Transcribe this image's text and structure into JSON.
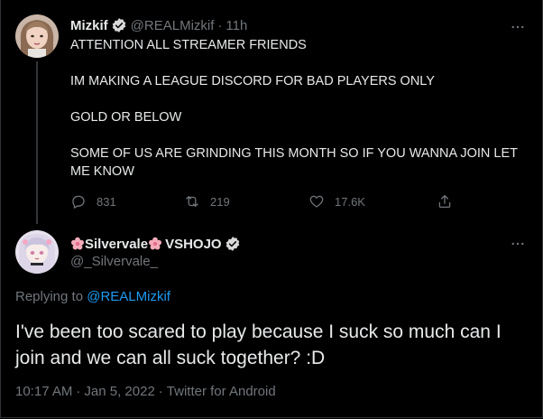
{
  "colors": {
    "background": "#000000",
    "text_primary": "#e7e9ea",
    "text_secondary": "#71767b",
    "link": "#1d9bf0",
    "verified": "#1d9bf0",
    "thread_line": "#333639"
  },
  "parent_tweet": {
    "avatar_icon": "mizkif-avatar",
    "display_name": "Mizkif",
    "handle": "@REALMizkif",
    "separator": "·",
    "time": "11h",
    "more_icon": "more-dots-icon",
    "paragraphs": [
      "ATTENTION ALL STREAMER FRIENDS",
      "IM MAKING A LEAGUE DISCORD FOR BAD PLAYERS ONLY",
      "GOLD OR BELOW",
      "SOME OF US ARE GRINDING THIS MONTH SO IF YOU WANNA JOIN LET ME KNOW"
    ],
    "actions": {
      "reply": {
        "icon": "reply-icon",
        "count": "831"
      },
      "retweet": {
        "icon": "retweet-icon",
        "count": "219"
      },
      "like": {
        "icon": "heart-icon",
        "count": "17.6K"
      },
      "share": {
        "icon": "share-icon"
      }
    }
  },
  "reply_tweet": {
    "avatar_icon": "silvervale-avatar",
    "display_name": "Silvervale",
    "display_name_suffix": "VSHOJO",
    "name_emoji_icon": "cherry-blossom-icon",
    "handle": "@_Silvervale_",
    "more_icon": "more-dots-icon",
    "replying_to_label": "Replying to",
    "replying_to_mention": "@REALMizkif",
    "text": "I've been too scared to play because I suck so much can I join and we can all suck together? :D",
    "time": "10:17 AM",
    "date": "Jan 5, 2022",
    "source": "Twitter for Android",
    "separator": "·"
  }
}
